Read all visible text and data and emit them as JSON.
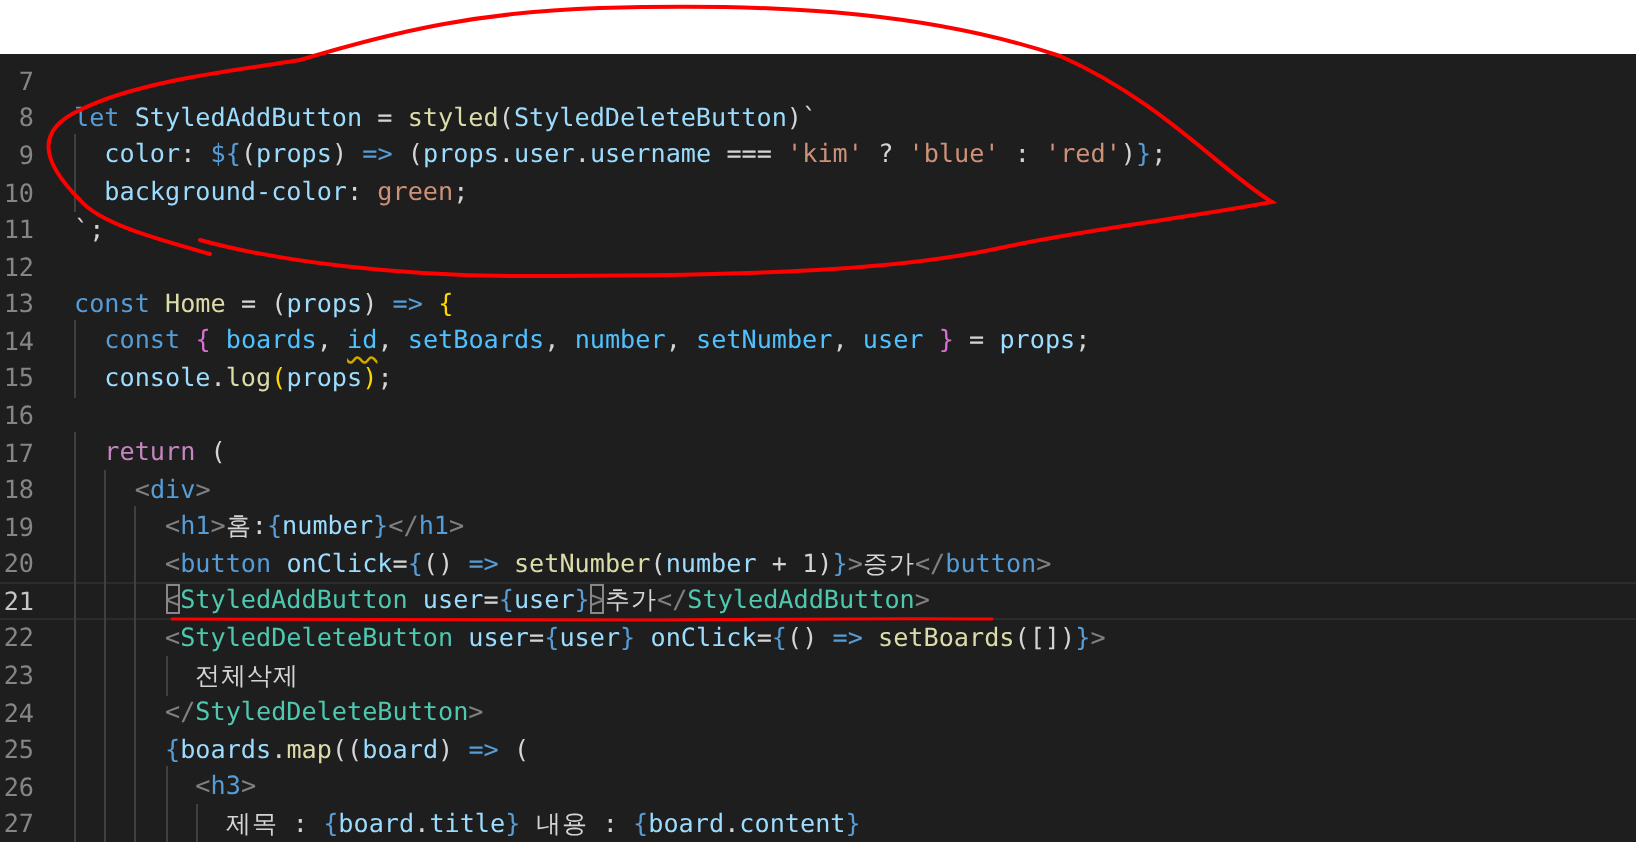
{
  "editor": {
    "lines": [
      {
        "number": "7",
        "current": false
      },
      {
        "number": "8",
        "current": false,
        "tokens": [
          {
            "text": "let",
            "kind": "keyword"
          },
          {
            "text": " StyledAddButton",
            "kind": "variable"
          },
          {
            "text": " = ",
            "kind": "plain"
          },
          {
            "text": "styled",
            "kind": "function"
          },
          {
            "text": "(",
            "kind": "plain"
          },
          {
            "text": "StyledDeleteButton",
            "kind": "variable"
          },
          {
            "text": ")`",
            "kind": "plain"
          }
        ]
      },
      {
        "number": "9",
        "current": false,
        "tokens": [
          {
            "text": "  color",
            "kind": "variable"
          },
          {
            "text": ": ",
            "kind": "plain"
          },
          {
            "text": "${",
            "kind": "keyword"
          },
          {
            "text": "(",
            "kind": "plain"
          },
          {
            "text": "props",
            "kind": "variable"
          },
          {
            "text": ") ",
            "kind": "plain"
          },
          {
            "text": "=>",
            "kind": "keyword"
          },
          {
            "text": " (",
            "kind": "plain"
          },
          {
            "text": "props",
            "kind": "variable"
          },
          {
            "text": ".",
            "kind": "plain"
          },
          {
            "text": "user",
            "kind": "variable"
          },
          {
            "text": ".",
            "kind": "plain"
          },
          {
            "text": "username",
            "kind": "variable"
          },
          {
            "text": " === ",
            "kind": "plain"
          },
          {
            "text": "'kim'",
            "kind": "string"
          },
          {
            "text": " ? ",
            "kind": "plain"
          },
          {
            "text": "'blue'",
            "kind": "string"
          },
          {
            "text": " : ",
            "kind": "plain"
          },
          {
            "text": "'red'",
            "kind": "string"
          },
          {
            "text": ")",
            "kind": "plain"
          },
          {
            "text": "}",
            "kind": "keyword"
          },
          {
            "text": ";",
            "kind": "plain"
          }
        ]
      },
      {
        "number": "10",
        "current": false,
        "tokens": [
          {
            "text": "  background-color",
            "kind": "variable"
          },
          {
            "text": ": ",
            "kind": "plain"
          },
          {
            "text": "green",
            "kind": "string"
          },
          {
            "text": ";",
            "kind": "plain"
          }
        ]
      },
      {
        "number": "11",
        "current": false,
        "tokens": [
          {
            "text": "`;",
            "kind": "plain"
          }
        ]
      },
      {
        "number": "12",
        "current": false
      },
      {
        "number": "13",
        "current": false,
        "tokens": [
          {
            "text": "const",
            "kind": "keyword"
          },
          {
            "text": " Home",
            "kind": "function"
          },
          {
            "text": " = (",
            "kind": "plain"
          },
          {
            "text": "props",
            "kind": "variable"
          },
          {
            "text": ") ",
            "kind": "plain"
          },
          {
            "text": "=>",
            "kind": "keyword"
          },
          {
            "text": " {",
            "kind": "brace"
          }
        ]
      },
      {
        "number": "14",
        "current": false,
        "tokens": [
          {
            "text": "  const",
            "kind": "keyword"
          },
          {
            "text": " {",
            "kind": "brace-inner"
          },
          {
            "text": " boards",
            "kind": "constant"
          },
          {
            "text": ", ",
            "kind": "plain"
          },
          {
            "text": "id",
            "kind": "constant-warning"
          },
          {
            "text": ", ",
            "kind": "plain"
          },
          {
            "text": "setBoards",
            "kind": "constant"
          },
          {
            "text": ", ",
            "kind": "plain"
          },
          {
            "text": "number",
            "kind": "constant"
          },
          {
            "text": ", ",
            "kind": "plain"
          },
          {
            "text": "setNumber",
            "kind": "constant"
          },
          {
            "text": ", ",
            "kind": "plain"
          },
          {
            "text": "user",
            "kind": "constant"
          },
          {
            "text": " }",
            "kind": "brace-inner"
          },
          {
            "text": " = ",
            "kind": "plain"
          },
          {
            "text": "props",
            "kind": "variable"
          },
          {
            "text": ";",
            "kind": "plain"
          }
        ]
      },
      {
        "number": "15",
        "current": false,
        "tokens": [
          {
            "text": "  console",
            "kind": "variable"
          },
          {
            "text": ".",
            "kind": "plain"
          },
          {
            "text": "log",
            "kind": "function"
          },
          {
            "text": "(",
            "kind": "brace"
          },
          {
            "text": "props",
            "kind": "variable"
          },
          {
            "text": ")",
            "kind": "brace"
          },
          {
            "text": ";",
            "kind": "plain"
          }
        ]
      },
      {
        "number": "16",
        "current": false
      },
      {
        "number": "17",
        "current": false,
        "tokens": [
          {
            "text": "  return",
            "kind": "control"
          },
          {
            "text": " (",
            "kind": "plain"
          }
        ]
      },
      {
        "number": "18",
        "current": false,
        "tokens": [
          {
            "text": "    <",
            "kind": "tag-punct"
          },
          {
            "text": "div",
            "kind": "tag"
          },
          {
            "text": ">",
            "kind": "tag-punct"
          }
        ]
      },
      {
        "number": "19",
        "current": false,
        "tokens": [
          {
            "text": "      <",
            "kind": "tag-punct"
          },
          {
            "text": "h1",
            "kind": "tag"
          },
          {
            "text": ">",
            "kind": "tag-punct"
          },
          {
            "text": "홈:",
            "kind": "plain"
          },
          {
            "text": "{",
            "kind": "keyword"
          },
          {
            "text": "number",
            "kind": "variable"
          },
          {
            "text": "}",
            "kind": "keyword"
          },
          {
            "text": "</",
            "kind": "tag-punct"
          },
          {
            "text": "h1",
            "kind": "tag"
          },
          {
            "text": ">",
            "kind": "tag-punct"
          }
        ]
      },
      {
        "number": "20",
        "current": false,
        "tokens": [
          {
            "text": "      <",
            "kind": "tag-punct"
          },
          {
            "text": "button",
            "kind": "tag"
          },
          {
            "text": " onClick",
            "kind": "variable"
          },
          {
            "text": "=",
            "kind": "plain"
          },
          {
            "text": "{",
            "kind": "keyword"
          },
          {
            "text": "() ",
            "kind": "plain"
          },
          {
            "text": "=>",
            "kind": "keyword"
          },
          {
            "text": " setNumber",
            "kind": "function"
          },
          {
            "text": "(",
            "kind": "plain"
          },
          {
            "text": "number",
            "kind": "variable"
          },
          {
            "text": " + 1)",
            "kind": "plain"
          },
          {
            "text": "}",
            "kind": "keyword"
          },
          {
            "text": ">",
            "kind": "tag-punct"
          },
          {
            "text": "증가",
            "kind": "plain"
          },
          {
            "text": "</",
            "kind": "tag-punct"
          },
          {
            "text": "button",
            "kind": "tag"
          },
          {
            "text": ">",
            "kind": "tag-punct"
          }
        ]
      },
      {
        "number": "21",
        "current": true,
        "tokens": [
          {
            "text": "      <",
            "kind": "tag-punct-matched"
          },
          {
            "text": "StyledAddButton",
            "kind": "component"
          },
          {
            "text": " user",
            "kind": "variable"
          },
          {
            "text": "=",
            "kind": "plain"
          },
          {
            "text": "{",
            "kind": "keyword"
          },
          {
            "text": "user",
            "kind": "variable"
          },
          {
            "text": "}",
            "kind": "keyword"
          },
          {
            "text": ">",
            "kind": "tag-punct-matched"
          },
          {
            "text": "추가",
            "kind": "plain"
          },
          {
            "text": "</",
            "kind": "tag-punct"
          },
          {
            "text": "StyledAddButton",
            "kind": "component"
          },
          {
            "text": ">",
            "kind": "tag-punct"
          }
        ]
      },
      {
        "number": "22",
        "current": false,
        "tokens": [
          {
            "text": "      <",
            "kind": "tag-punct"
          },
          {
            "text": "StyledDeleteButton",
            "kind": "component"
          },
          {
            "text": " user",
            "kind": "variable"
          },
          {
            "text": "=",
            "kind": "plain"
          },
          {
            "text": "{",
            "kind": "keyword"
          },
          {
            "text": "user",
            "kind": "variable"
          },
          {
            "text": "}",
            "kind": "keyword"
          },
          {
            "text": " onClick",
            "kind": "variable"
          },
          {
            "text": "=",
            "kind": "plain"
          },
          {
            "text": "{",
            "kind": "keyword"
          },
          {
            "text": "() ",
            "kind": "plain"
          },
          {
            "text": "=>",
            "kind": "keyword"
          },
          {
            "text": " setBoards",
            "kind": "function"
          },
          {
            "text": "([])",
            "kind": "plain"
          },
          {
            "text": "}",
            "kind": "keyword"
          },
          {
            "text": ">",
            "kind": "tag-punct"
          }
        ]
      },
      {
        "number": "23",
        "current": false,
        "tokens": [
          {
            "text": "        전체삭제",
            "kind": "plain"
          }
        ]
      },
      {
        "number": "24",
        "current": false,
        "tokens": [
          {
            "text": "      </",
            "kind": "tag-punct"
          },
          {
            "text": "StyledDeleteButton",
            "kind": "component"
          },
          {
            "text": ">",
            "kind": "tag-punct"
          }
        ]
      },
      {
        "number": "25",
        "current": false,
        "tokens": [
          {
            "text": "      {",
            "kind": "keyword"
          },
          {
            "text": "boards",
            "kind": "variable"
          },
          {
            "text": ".",
            "kind": "plain"
          },
          {
            "text": "map",
            "kind": "function"
          },
          {
            "text": "((",
            "kind": "plain"
          },
          {
            "text": "board",
            "kind": "variable"
          },
          {
            "text": ") ",
            "kind": "plain"
          },
          {
            "text": "=>",
            "kind": "keyword"
          },
          {
            "text": " (",
            "kind": "plain"
          }
        ]
      },
      {
        "number": "26",
        "current": false,
        "tokens": [
          {
            "text": "        <",
            "kind": "tag-punct"
          },
          {
            "text": "h3",
            "kind": "tag"
          },
          {
            "text": ">",
            "kind": "tag-punct"
          }
        ]
      },
      {
        "number": "27",
        "current": false,
        "tokens": [
          {
            "text": "          제목 : ",
            "kind": "plain"
          },
          {
            "text": "{",
            "kind": "keyword"
          },
          {
            "text": "board",
            "kind": "variable"
          },
          {
            "text": ".",
            "kind": "plain"
          },
          {
            "text": "title",
            "kind": "variable"
          },
          {
            "text": "}",
            "kind": "keyword"
          },
          {
            "text": " 내용 : ",
            "kind": "plain"
          },
          {
            "text": "{",
            "kind": "keyword"
          },
          {
            "text": "board",
            "kind": "variable"
          },
          {
            "text": ".",
            "kind": "plain"
          },
          {
            "text": "content",
            "kind": "variable"
          },
          {
            "text": "}",
            "kind": "keyword"
          }
        ]
      }
    ]
  }
}
